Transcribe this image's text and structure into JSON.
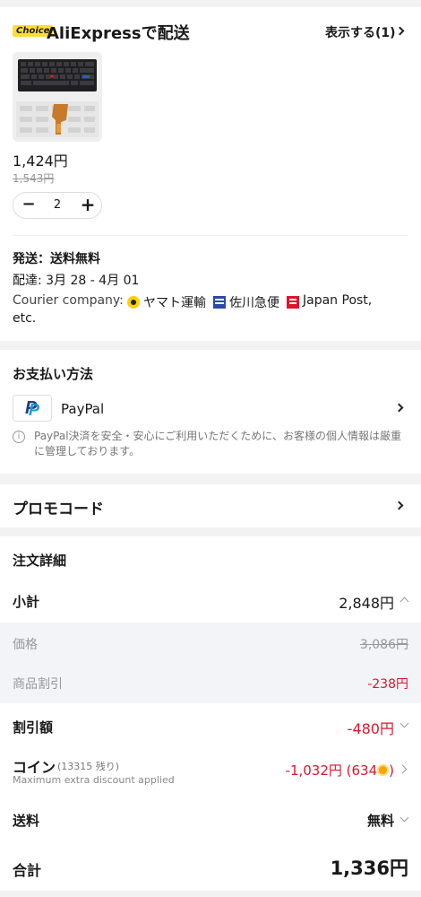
{
  "shipping_section": {
    "choice_badge": "Choice",
    "title": "AliExpressで配送",
    "show_link": "表示する(1)",
    "item": {
      "price": "1,424円",
      "original_price": "1,543円",
      "quantity": "2",
      "minus_symbol": "−",
      "plus_symbol": "+"
    },
    "shipping_label": "発送：送料無料",
    "delivery_label": "配達: 3月 28 - 4月 01",
    "courier_prefix": "Courier company:",
    "courier_yamato": "ヤマト運輸",
    "courier_sagawa": "佐川急便",
    "courier_japanpost": "Japan Post,",
    "courier_etc": "etc."
  },
  "payment_section": {
    "title": "お支払い方法",
    "method_name": "PayPal",
    "notice": "PayPal決済を安全・安心にご利用いただくために、お客様の個人情報は厳重に管理しております。"
  },
  "promo_section": {
    "title": "プロモコード"
  },
  "order_details": {
    "title": "注文詳細",
    "subtotal_label": "小計",
    "subtotal_value": "2,848円",
    "price_label": "価格",
    "price_value": "3,086円",
    "item_discount_label": "商品割引",
    "item_discount_value": "-238円",
    "discount_label": "割引額",
    "discount_value": "-480円",
    "coin_label": "コイン",
    "coin_remaining": "(13315 残り)",
    "coin_sub": "Maximum extra discount applied",
    "coin_value_part1": "-1,032円 (634",
    "coin_value_part2": ")",
    "shipping_label": "送料",
    "shipping_value": "無料",
    "total_label": "合計",
    "total_value": "1,336円"
  },
  "colors": {
    "accent_red": "#e0142b",
    "choice_yellow": "#ffdd33",
    "paypal_blue": "#253b80",
    "coin_orange": "#f7a600"
  }
}
